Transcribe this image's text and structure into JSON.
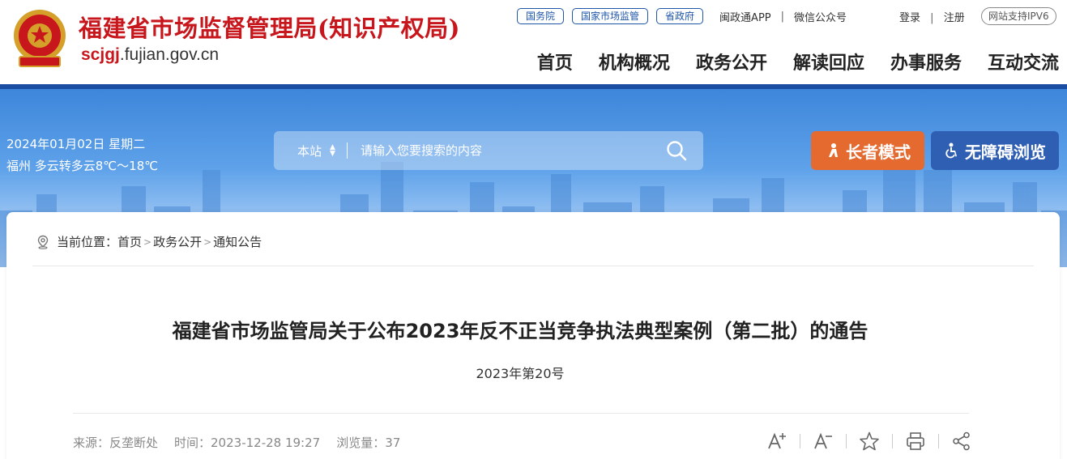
{
  "header": {
    "site_title": "福建省市场监督管理局(知识产权局)",
    "domain_highlight": "scjgj",
    "domain_rest": ".fujian.gov.cn",
    "top_pills": [
      "国务院",
      "国家市场监管",
      "省政府"
    ],
    "app_link": "闽政通APP",
    "wechat_link": "微信公众号",
    "login": "登录",
    "register": "注册",
    "ipv6": "网站支持IPV6",
    "nav": [
      "首页",
      "机构概况",
      "政务公开",
      "解读回应",
      "办事服务",
      "互动交流"
    ]
  },
  "banner": {
    "date": "2024年01月02日 星期二",
    "weather": "福州 多云转多云8℃～18℃",
    "search_scope": "本站",
    "search_placeholder": "请输入您要搜索的内容",
    "elder_mode": "长者模式",
    "accessible": "无障碍浏览"
  },
  "breadcrumb": {
    "prefix": "当前位置：",
    "items": [
      "首页",
      "政务公开",
      "通知公告"
    ]
  },
  "article": {
    "title": "福建省市场监管局关于公布2023年反不正当竞争执法典型案例（第二批）的通告",
    "doc_no": "2023年第20号",
    "source": "来源：反垄断处",
    "time": "时间：2023-12-28 19:27",
    "views": "浏览量：37"
  },
  "colors": {
    "brand_red": "#c8161d",
    "nav_blue": "#1b4ea3",
    "elder_orange": "#e46a2f",
    "access_blue": "#2f5fb3"
  }
}
